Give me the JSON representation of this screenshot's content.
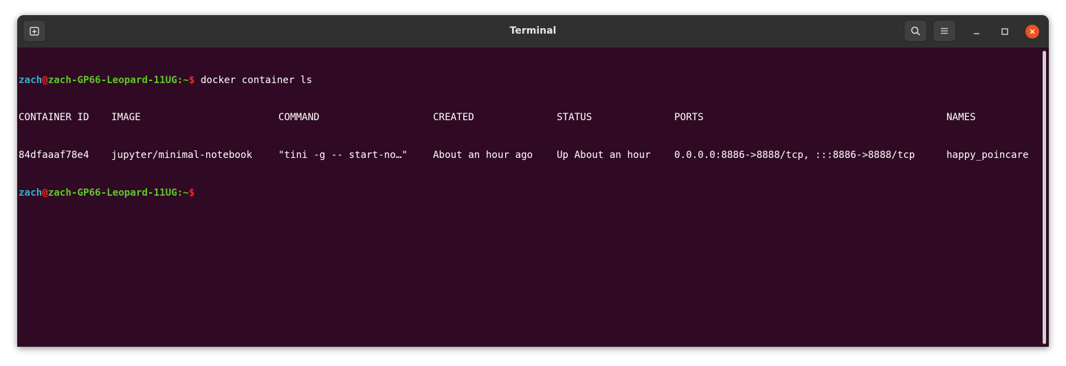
{
  "window": {
    "title": "Terminal"
  },
  "prompt": {
    "user": "zach",
    "at": "@",
    "host": "zach-GP66-Leopard-11UG",
    "path": ":~",
    "symbol": "$"
  },
  "command": " docker container ls",
  "table": {
    "headers": [
      "CONTAINER ID",
      "IMAGE",
      "COMMAND",
      "CREATED",
      "STATUS",
      "PORTS",
      "NAMES"
    ],
    "rows": [
      [
        "84dfaaaf78e4",
        "jupyter/minimal-notebook",
        "\"tini -g -- start-no…\"",
        "About an hour ago",
        "Up About an hour",
        "0.0.0.0:8886->8888/tcp, :::8886->8888/tcp",
        "happy_poincare"
      ]
    ]
  },
  "colors": {
    "background": "#300a24",
    "titlebar": "#303030",
    "user": "#34b1c9",
    "host": "#5ec926",
    "prompt_symbol": "#ef2929",
    "close_button": "#e95420"
  },
  "icons": {
    "new_tab": "new-tab-icon",
    "search": "search-icon",
    "menu": "hamburger-menu-icon",
    "minimize": "minimize-icon",
    "maximize": "maximize-icon",
    "close": "close-icon"
  }
}
